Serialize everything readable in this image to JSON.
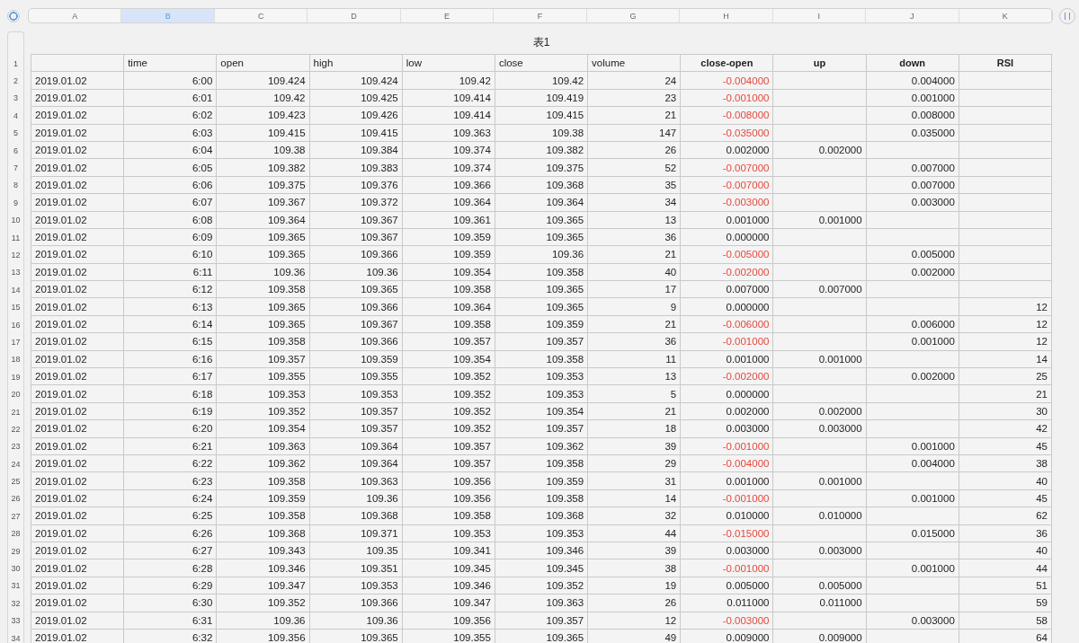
{
  "table": {
    "title": "表1",
    "columns": [
      {
        "letter": "A",
        "selected": false
      },
      {
        "letter": "B",
        "header": "time",
        "selected": true
      },
      {
        "letter": "C",
        "header": "open",
        "selected": false
      },
      {
        "letter": "D",
        "header": "high",
        "selected": false
      },
      {
        "letter": "E",
        "header": "low",
        "selected": false
      },
      {
        "letter": "F",
        "header": "close",
        "selected": false
      },
      {
        "letter": "G",
        "header": "volume",
        "selected": false
      },
      {
        "letter": "H",
        "header": "close-open",
        "selected": false
      },
      {
        "letter": "I",
        "header": "up",
        "selected": false
      },
      {
        "letter": "J",
        "header": "down",
        "selected": false
      },
      {
        "letter": "K",
        "header": "RSI",
        "selected": false
      }
    ],
    "header_row_number": "1",
    "rows": [
      {
        "n": "2",
        "negative": true,
        "cells": [
          "2019.01.02",
          "6:00",
          "109.424",
          "109.424",
          "109.42",
          "109.42",
          "24",
          "-0.004000",
          null,
          "0.004000",
          null
        ]
      },
      {
        "n": "3",
        "negative": true,
        "cells": [
          "2019.01.02",
          "6:01",
          "109.42",
          "109.425",
          "109.414",
          "109.419",
          "23",
          "-0.001000",
          null,
          "0.001000",
          null
        ]
      },
      {
        "n": "4",
        "negative": true,
        "cells": [
          "2019.01.02",
          "6:02",
          "109.423",
          "109.426",
          "109.414",
          "109.415",
          "21",
          "-0.008000",
          null,
          "0.008000",
          null
        ]
      },
      {
        "n": "5",
        "negative": true,
        "cells": [
          "2019.01.02",
          "6:03",
          "109.415",
          "109.415",
          "109.363",
          "109.38",
          "147",
          "-0.035000",
          null,
          "0.035000",
          null
        ]
      },
      {
        "n": "6",
        "negative": false,
        "cells": [
          "2019.01.02",
          "6:04",
          "109.38",
          "109.384",
          "109.374",
          "109.382",
          "26",
          "0.002000",
          "0.002000",
          null,
          null
        ]
      },
      {
        "n": "7",
        "negative": true,
        "cells": [
          "2019.01.02",
          "6:05",
          "109.382",
          "109.383",
          "109.374",
          "109.375",
          "52",
          "-0.007000",
          null,
          "0.007000",
          null
        ]
      },
      {
        "n": "8",
        "negative": true,
        "cells": [
          "2019.01.02",
          "6:06",
          "109.375",
          "109.376",
          "109.366",
          "109.368",
          "35",
          "-0.007000",
          null,
          "0.007000",
          null
        ]
      },
      {
        "n": "9",
        "negative": true,
        "cells": [
          "2019.01.02",
          "6:07",
          "109.367",
          "109.372",
          "109.364",
          "109.364",
          "34",
          "-0.003000",
          null,
          "0.003000",
          null
        ]
      },
      {
        "n": "10",
        "negative": false,
        "cells": [
          "2019.01.02",
          "6:08",
          "109.364",
          "109.367",
          "109.361",
          "109.365",
          "13",
          "0.001000",
          "0.001000",
          null,
          null
        ]
      },
      {
        "n": "11",
        "negative": false,
        "cells": [
          "2019.01.02",
          "6:09",
          "109.365",
          "109.367",
          "109.359",
          "109.365",
          "36",
          "0.000000",
          null,
          null,
          null
        ]
      },
      {
        "n": "12",
        "negative": true,
        "cells": [
          "2019.01.02",
          "6:10",
          "109.365",
          "109.366",
          "109.359",
          "109.36",
          "21",
          "-0.005000",
          null,
          "0.005000",
          null
        ]
      },
      {
        "n": "13",
        "negative": true,
        "cells": [
          "2019.01.02",
          "6:11",
          "109.36",
          "109.36",
          "109.354",
          "109.358",
          "40",
          "-0.002000",
          null,
          "0.002000",
          null
        ]
      },
      {
        "n": "14",
        "negative": false,
        "cells": [
          "2019.01.02",
          "6:12",
          "109.358",
          "109.365",
          "109.358",
          "109.365",
          "17",
          "0.007000",
          "0.007000",
          null,
          null
        ]
      },
      {
        "n": "15",
        "negative": false,
        "cells": [
          "2019.01.02",
          "6:13",
          "109.365",
          "109.366",
          "109.364",
          "109.365",
          "9",
          "0.000000",
          null,
          null,
          "12"
        ]
      },
      {
        "n": "16",
        "negative": true,
        "cells": [
          "2019.01.02",
          "6:14",
          "109.365",
          "109.367",
          "109.358",
          "109.359",
          "21",
          "-0.006000",
          null,
          "0.006000",
          "12"
        ]
      },
      {
        "n": "17",
        "negative": true,
        "cells": [
          "2019.01.02",
          "6:15",
          "109.358",
          "109.366",
          "109.357",
          "109.357",
          "36",
          "-0.001000",
          null,
          "0.001000",
          "12"
        ]
      },
      {
        "n": "18",
        "negative": false,
        "cells": [
          "2019.01.02",
          "6:16",
          "109.357",
          "109.359",
          "109.354",
          "109.358",
          "11",
          "0.001000",
          "0.001000",
          null,
          "14"
        ]
      },
      {
        "n": "19",
        "negative": true,
        "cells": [
          "2019.01.02",
          "6:17",
          "109.355",
          "109.355",
          "109.352",
          "109.353",
          "13",
          "-0.002000",
          null,
          "0.002000",
          "25"
        ]
      },
      {
        "n": "20",
        "negative": false,
        "cells": [
          "2019.01.02",
          "6:18",
          "109.353",
          "109.353",
          "109.352",
          "109.353",
          "5",
          "0.000000",
          null,
          null,
          "21"
        ]
      },
      {
        "n": "21",
        "negative": false,
        "cells": [
          "2019.01.02",
          "6:19",
          "109.352",
          "109.357",
          "109.352",
          "109.354",
          "21",
          "0.002000",
          "0.002000",
          null,
          "30"
        ]
      },
      {
        "n": "22",
        "negative": false,
        "cells": [
          "2019.01.02",
          "6:20",
          "109.354",
          "109.357",
          "109.352",
          "109.357",
          "18",
          "0.003000",
          "0.003000",
          null,
          "42"
        ]
      },
      {
        "n": "23",
        "negative": true,
        "cells": [
          "2019.01.02",
          "6:21",
          "109.363",
          "109.364",
          "109.357",
          "109.362",
          "39",
          "-0.001000",
          null,
          "0.001000",
          "45"
        ]
      },
      {
        "n": "24",
        "negative": true,
        "cells": [
          "2019.01.02",
          "6:22",
          "109.362",
          "109.364",
          "109.357",
          "109.358",
          "29",
          "-0.004000",
          null,
          "0.004000",
          "38"
        ]
      },
      {
        "n": "25",
        "negative": false,
        "cells": [
          "2019.01.02",
          "6:23",
          "109.358",
          "109.363",
          "109.356",
          "109.359",
          "31",
          "0.001000",
          "0.001000",
          null,
          "40"
        ]
      },
      {
        "n": "26",
        "negative": true,
        "cells": [
          "2019.01.02",
          "6:24",
          "109.359",
          "109.36",
          "109.356",
          "109.358",
          "14",
          "-0.001000",
          null,
          "0.001000",
          "45"
        ]
      },
      {
        "n": "27",
        "negative": false,
        "cells": [
          "2019.01.02",
          "6:25",
          "109.358",
          "109.368",
          "109.358",
          "109.368",
          "32",
          "0.010000",
          "0.010000",
          null,
          "62"
        ]
      },
      {
        "n": "28",
        "negative": true,
        "cells": [
          "2019.01.02",
          "6:26",
          "109.368",
          "109.371",
          "109.353",
          "109.353",
          "44",
          "-0.015000",
          null,
          "0.015000",
          "36"
        ]
      },
      {
        "n": "29",
        "negative": false,
        "cells": [
          "2019.01.02",
          "6:27",
          "109.343",
          "109.35",
          "109.341",
          "109.346",
          "39",
          "0.003000",
          "0.003000",
          null,
          "40"
        ]
      },
      {
        "n": "30",
        "negative": true,
        "cells": [
          "2019.01.02",
          "6:28",
          "109.346",
          "109.351",
          "109.345",
          "109.345",
          "38",
          "-0.001000",
          null,
          "0.001000",
          "44"
        ]
      },
      {
        "n": "31",
        "negative": false,
        "cells": [
          "2019.01.02",
          "6:29",
          "109.347",
          "109.353",
          "109.346",
          "109.352",
          "19",
          "0.005000",
          "0.005000",
          null,
          "51"
        ]
      },
      {
        "n": "32",
        "negative": false,
        "cells": [
          "2019.01.02",
          "6:30",
          "109.352",
          "109.366",
          "109.347",
          "109.363",
          "26",
          "0.011000",
          "0.011000",
          null,
          "59"
        ]
      },
      {
        "n": "33",
        "negative": true,
        "cells": [
          "2019.01.02",
          "6:31",
          "109.36",
          "109.36",
          "109.356",
          "109.357",
          "12",
          "-0.003000",
          null,
          "0.003000",
          "58"
        ]
      },
      {
        "n": "34",
        "negative": false,
        "cells": [
          "2019.01.02",
          "6:32",
          "109.356",
          "109.365",
          "109.355",
          "109.365",
          "49",
          "0.009000",
          "0.009000",
          null,
          "64"
        ]
      }
    ]
  }
}
